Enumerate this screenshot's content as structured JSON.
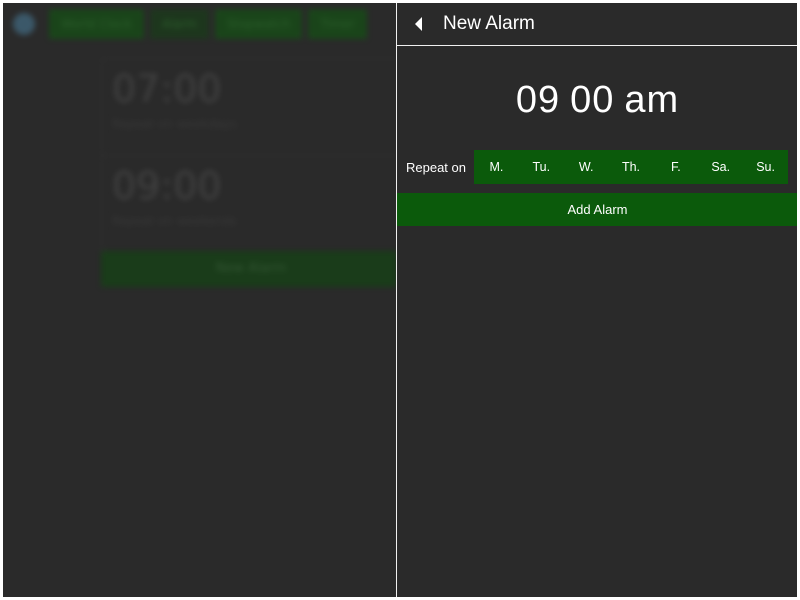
{
  "background_app": {
    "tabs": [
      "World Clock",
      "Alarm",
      "Stopwatch",
      "Timer"
    ],
    "alarms": [
      {
        "time": "07:00",
        "subtitle": "Repeat on weekdays"
      },
      {
        "time": "09:00",
        "subtitle": "Repeat on weekends"
      }
    ],
    "button_label": "New Alarm"
  },
  "panel": {
    "title": "New Alarm",
    "back_icon": "chevron-left-icon",
    "time": {
      "hour": "09",
      "minute": "00",
      "period": "am"
    },
    "repeat_label": "Repeat on",
    "days": [
      "M.",
      "Tu.",
      "W.",
      "Th.",
      "F.",
      "Sa.",
      "Su."
    ],
    "add_button_label": "Add Alarm"
  },
  "colors": {
    "background": "#2a2a2a",
    "accent_green": "#0b5a0b",
    "text": "#ffffff",
    "divider": "#f0f0f0"
  }
}
